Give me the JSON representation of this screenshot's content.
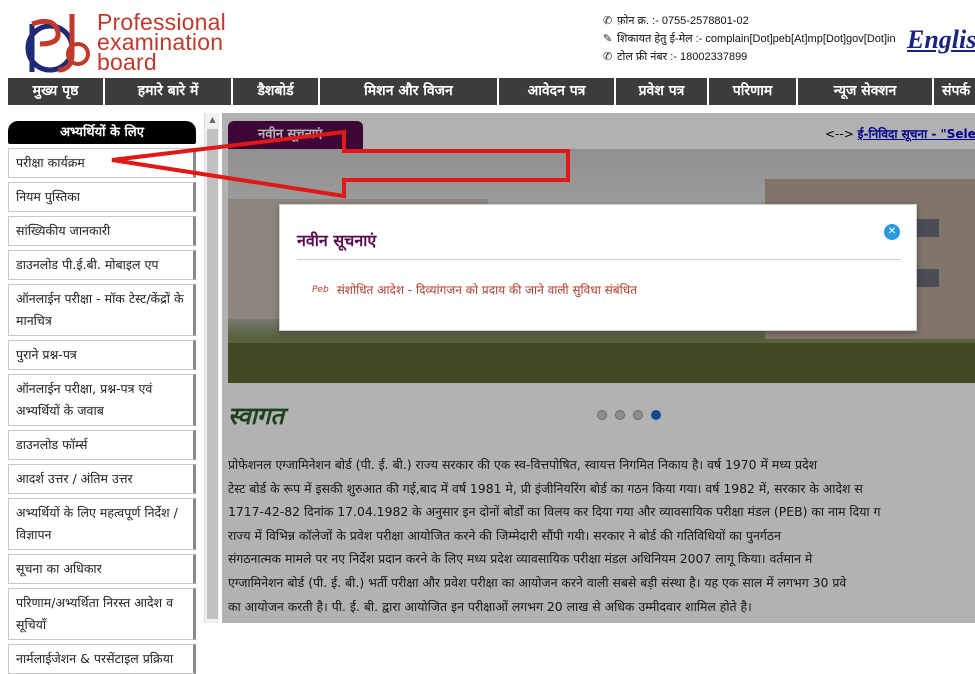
{
  "header": {
    "logo_lines": [
      "Professional",
      "examination",
      "board"
    ],
    "contact": [
      {
        "icon": "phone-icon",
        "text": "फ़ोन क्र. :- 0755-2578801-02"
      },
      {
        "icon": "mail-icon",
        "text": "शिकायत हेतु ई-मेल :- complain[Dot]peb[At]mp[Dot]gov[Dot]in"
      },
      {
        "icon": "phone-icon",
        "text": "टोल फ्री नंबर :- 18002337899"
      }
    ],
    "english_link": "English"
  },
  "nav": [
    "मुख्य पृष्ठ",
    "हमारे बारे में",
    "डैशबोर्ड",
    "मिशन और विजन",
    "आवेदन पत्र",
    "प्रवेश पत्र",
    "परिणाम",
    "न्यूज सेक्शन",
    "संपर्क"
  ],
  "sidebar": {
    "heading": "अभ्यर्थियों के लिए",
    "items": [
      "परीक्षा कार्यक्रम",
      "नियम पुस्तिका",
      "सांख्यिकीय जानकारी",
      "डाउनलोड पी.ई.बी. मोबाइल एप",
      "ऑनलाईन परीक्षा - मॉक टेस्ट/केंद्रों के मानचित्र",
      "पुराने प्रश्न-पत्र",
      "ऑनलाईन परीक्षा, प्रश्न-पत्र एवं अभ्यर्थियों के जवाब",
      "डाउनलोड फॉर्म्स",
      "आदर्श उत्तर / अंतिम उत्तर",
      "अभ्यर्थियों के लिए महत्वपूर्ण निर्देश / विज्ञापन",
      "सूचना का अधिकार",
      "परिणाम/अभ्यर्थिता निरस्त आदेश व सूचियॉं",
      "नार्मलाईजेशन & परसेंटाइल प्रक्रिया"
    ]
  },
  "main": {
    "news_tab": "नवीन सूचनाएं",
    "ticker_prefix": "<--> ",
    "ticker_link": "ई-निविदा सूचना - \"Selec",
    "welcome": "स्वागत",
    "paragraph_lines": [
      "प्रोफेशनल एग्जामिनेशन बोर्ड (पी. ई. बी.) राज्य सरकार की एक स्व-वित्तपोषित, स्वायत्त निगमित निकाय है। वर्ष 1970 में मध्य प्रदेश",
      "टेस्ट बोर्ड के रूप में इसकी शुरुआत की गई,बाद में वर्ष 1981 मे, प्री इंजीनियरिंग बोर्ड का गठन किया गया। वर्ष 1982 में, सरकार के आदेश स",
      "1717-42-82 दिनांक 17.04.1982 के अनुसार इन दोनों बोर्डों का विलय कर दिया गया और व्यावसायिक परीक्षा मंडल (PEB) का नाम दिया ग",
      "राज्य में विभिन्न कॉलेजों के प्रवेश परीक्षा आयोजित करने की जिम्मेदारी सौंपी गयी। सरकार ने बोर्ड की गतिविधियों का पुनर्गठन",
      "संगठनात्मक मामले पर नए निर्देश प्रदान करने के लिए मध्य प्रदेश व्यावसायिक परीक्षा मंडल अधिनियम 2007 लागू किया। वर्तमान मे",
      "एग्जामिनेशन बोर्ड (पी. ई. बी.) भर्ती परीक्षा और प्रवेश परीक्षा का आयोजन करने वाली सबसे बड़ी संस्था है। यह एक साल में लगभग 30 प्रवे",
      "का आयोजन करती है। पी. ई. बी. द्वारा आयोजित इन परीक्षाओं लगभग 20 लाख से अधिक उम्मीदवार शामिल होते है।"
    ],
    "slider_dots": 4,
    "slider_active": 4
  },
  "modal": {
    "title": "नवीन सूचनाएं",
    "close_icon": "close-icon",
    "item_text": "संशोधित आदेश -  दिव्यांगजन को प्रदाय की जाने वाली सुविधा संबंधित",
    "item_icon_label": "Peb"
  },
  "colors": {
    "brand_red": "#c0392b",
    "nav_bg": "#3c3c3c",
    "accent_purple": "#5a0a4e",
    "arrow_red": "#e01818",
    "close_blue": "#2a9ae0"
  }
}
